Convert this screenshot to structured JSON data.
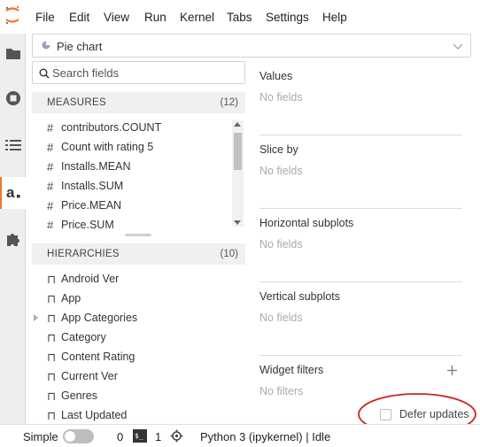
{
  "menu": {
    "items": [
      "File",
      "Edit",
      "View",
      "Run",
      "Kernel",
      "Tabs",
      "Settings",
      "Help"
    ]
  },
  "rail": {
    "icons": [
      "folder-icon",
      "running-icon",
      "toc-icon",
      "atoti-icon",
      "extension-icon"
    ]
  },
  "widget": {
    "chart_type": "Pie chart",
    "search_placeholder": "Search fields",
    "measures": {
      "title": "MEASURES",
      "count": "(12)",
      "items": [
        "contributors.COUNT",
        "Count with rating 5",
        "Installs.MEAN",
        "Installs.SUM",
        "Price.MEAN",
        "Price.SUM"
      ]
    },
    "hierarchies": {
      "title": "HIERARCHIES",
      "count": "(10)",
      "items": [
        "Android Ver",
        "App",
        "App Categories",
        "Category",
        "Content Rating",
        "Current Ver",
        "Genres",
        "Last Updated"
      ],
      "expandable": [
        false,
        false,
        true,
        false,
        false,
        false,
        false,
        false
      ]
    },
    "zones": [
      {
        "title": "Values",
        "empty": "No fields"
      },
      {
        "title": "Slice by",
        "empty": "No fields"
      },
      {
        "title": "Horizontal subplots",
        "empty": "No fields"
      },
      {
        "title": "Vertical subplots",
        "empty": "No fields"
      },
      {
        "title": "Widget filters",
        "empty": "No filters"
      }
    ],
    "defer_label": "Defer updates",
    "defer_checked": false
  },
  "status": {
    "mode_label": "Simple",
    "terminals": "0",
    "kernels": "1",
    "kernel_name": "Python 3 (ipykernel) | Idle"
  },
  "colors": {
    "accent": "#f37626",
    "annotation": "#cc2222"
  }
}
